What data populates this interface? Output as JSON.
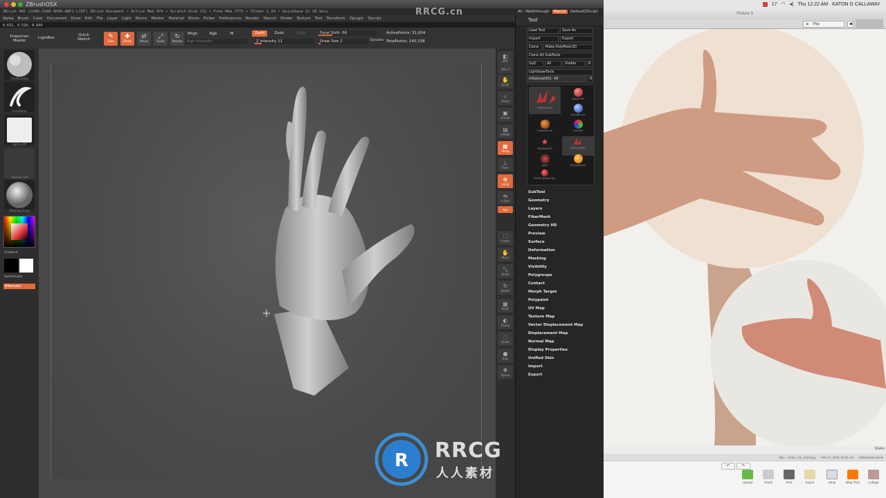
{
  "mac_menubar": {
    "battery": "17",
    "clock": "Thu 12:22 AM",
    "user": "KATON G CALLAWAY"
  },
  "zbrush": {
    "app_name": "ZBrushOSX",
    "info_line": "ZBrush 4R5 [SS88-ZSAE-XHDA-ABFJ-LJGF]    ZBrush Document    • Active Mem 474 • Scratch Disk 212 • Free Mem 2773 • ZTimer 1.34 • QuickSave In 10 Secs",
    "walkthrough": "AC: Walkthrough",
    "menus_btn": "Menus",
    "default_script": "DefaultZScript",
    "menus": [
      "Alpha",
      "Brush",
      "Color",
      "Document",
      "Draw",
      "Edit",
      "File",
      "Layer",
      "Light",
      "Macro",
      "Marker",
      "Material",
      "Movie",
      "Picker",
      "Preferences",
      "Render",
      "Stencil",
      "Stroke",
      "Texture",
      "Tool",
      "Transform",
      "Zplugin",
      "Zscript"
    ],
    "coords": "0.631, 0.518, 0.644",
    "toolbar": {
      "projection_master": "Projection Master",
      "lightbox": "LightBox",
      "quick_sketch": "Quick Sketch",
      "edit": "Edit",
      "draw": "Draw",
      "move": "Move",
      "scale": "Scale",
      "rotate": "Rotate",
      "mrgb": "Mrgb",
      "rgb": "Rgb",
      "m": "M",
      "rgb_intensity": "Rgb Intensity",
      "zadd": "Zadd",
      "zsub": "Zsub",
      "zcut": "Zcut",
      "z_intensity": "Z Intensity 11",
      "focal_shift": "Focal Shift -56",
      "draw_size": "Draw Size 2",
      "dynamic": "Dynamic",
      "active_points": "ActivePoints: 31,604",
      "total_points": "TotalPoints: 140,158"
    },
    "left_shelf": {
      "brush_label": "ClayBuildup",
      "stroke_label": "FreeHand",
      "alpha_label": "Alpha Off",
      "texture_label": "Texture Off",
      "material_label": "MatCap Gray",
      "gradient_label": "Gradient",
      "switch_color": "SwitchColor",
      "alternate": "Alternate"
    },
    "right_shelf": [
      "BPR",
      "SPix 3",
      "Scroll",
      "Zoom",
      "Actual",
      "AAHalf",
      "Persp",
      "Floor",
      "Local",
      "L.Sym",
      "Xyz",
      "Frame",
      "Move",
      "Scale",
      "Rotate",
      "PolyF",
      "Transp",
      "Ghost",
      "Solo",
      "Xpose"
    ],
    "tool_palette": {
      "title": "Tool",
      "load_tool": "Load Tool",
      "save_as": "Save As",
      "import": "Import",
      "export": "Export",
      "clone": "Clone",
      "make_polymesh": "Make PolyMesh3D",
      "clone_all": "Clone All SubTools",
      "goz": "GoZ",
      "all": "All",
      "visible": "Visible",
      "r": "R",
      "lightbox_tools": "Lightbox▸Tools",
      "current_tool": "mRaduse001. 48",
      "subtools": [
        "mRaduse001",
        "Sphere3D",
        "AlphaBrush",
        "CreaseBrush",
        "Cone3D",
        "PolyMesh3D",
        "mRaduse001",
        "eye3",
        "SimpleBrush",
        "PM3D_Sphere3D1"
      ],
      "subpalettes": [
        "SubTool",
        "Geometry",
        "Layers",
        "FiberMesh",
        "Geometry HD",
        "Preview",
        "Surface",
        "Deformation",
        "Masking",
        "Visibility",
        "Polygroups",
        "Contact",
        "Morph Target",
        "Polypaint",
        "UV Map",
        "Texture Map",
        "Vector Displacement Map",
        "Displacement Map",
        "Normal Map",
        "Display Properties",
        "Unified Skin",
        "Import",
        "Export"
      ]
    }
  },
  "preview": {
    "title": "Picture 3",
    "play": "Play",
    "make": "Make",
    "status_file": "Skin - Chain_1m_hand.jpg",
    "status_date": "Feb 27, 2008 10:35 AM",
    "status_size": "3008x2048 pixels",
    "actions": [
      "Upload",
      "Email",
      "Print",
      "Export",
      "Shop",
      "Blog This!",
      "Collage"
    ]
  },
  "watermark": {
    "big": "RRCG",
    "sub": "人人素材",
    "top": "RRCG.cn"
  },
  "colors": {
    "accent": "#e06a3c",
    "zbrush_bg": "#484848",
    "panel": "#262626"
  }
}
